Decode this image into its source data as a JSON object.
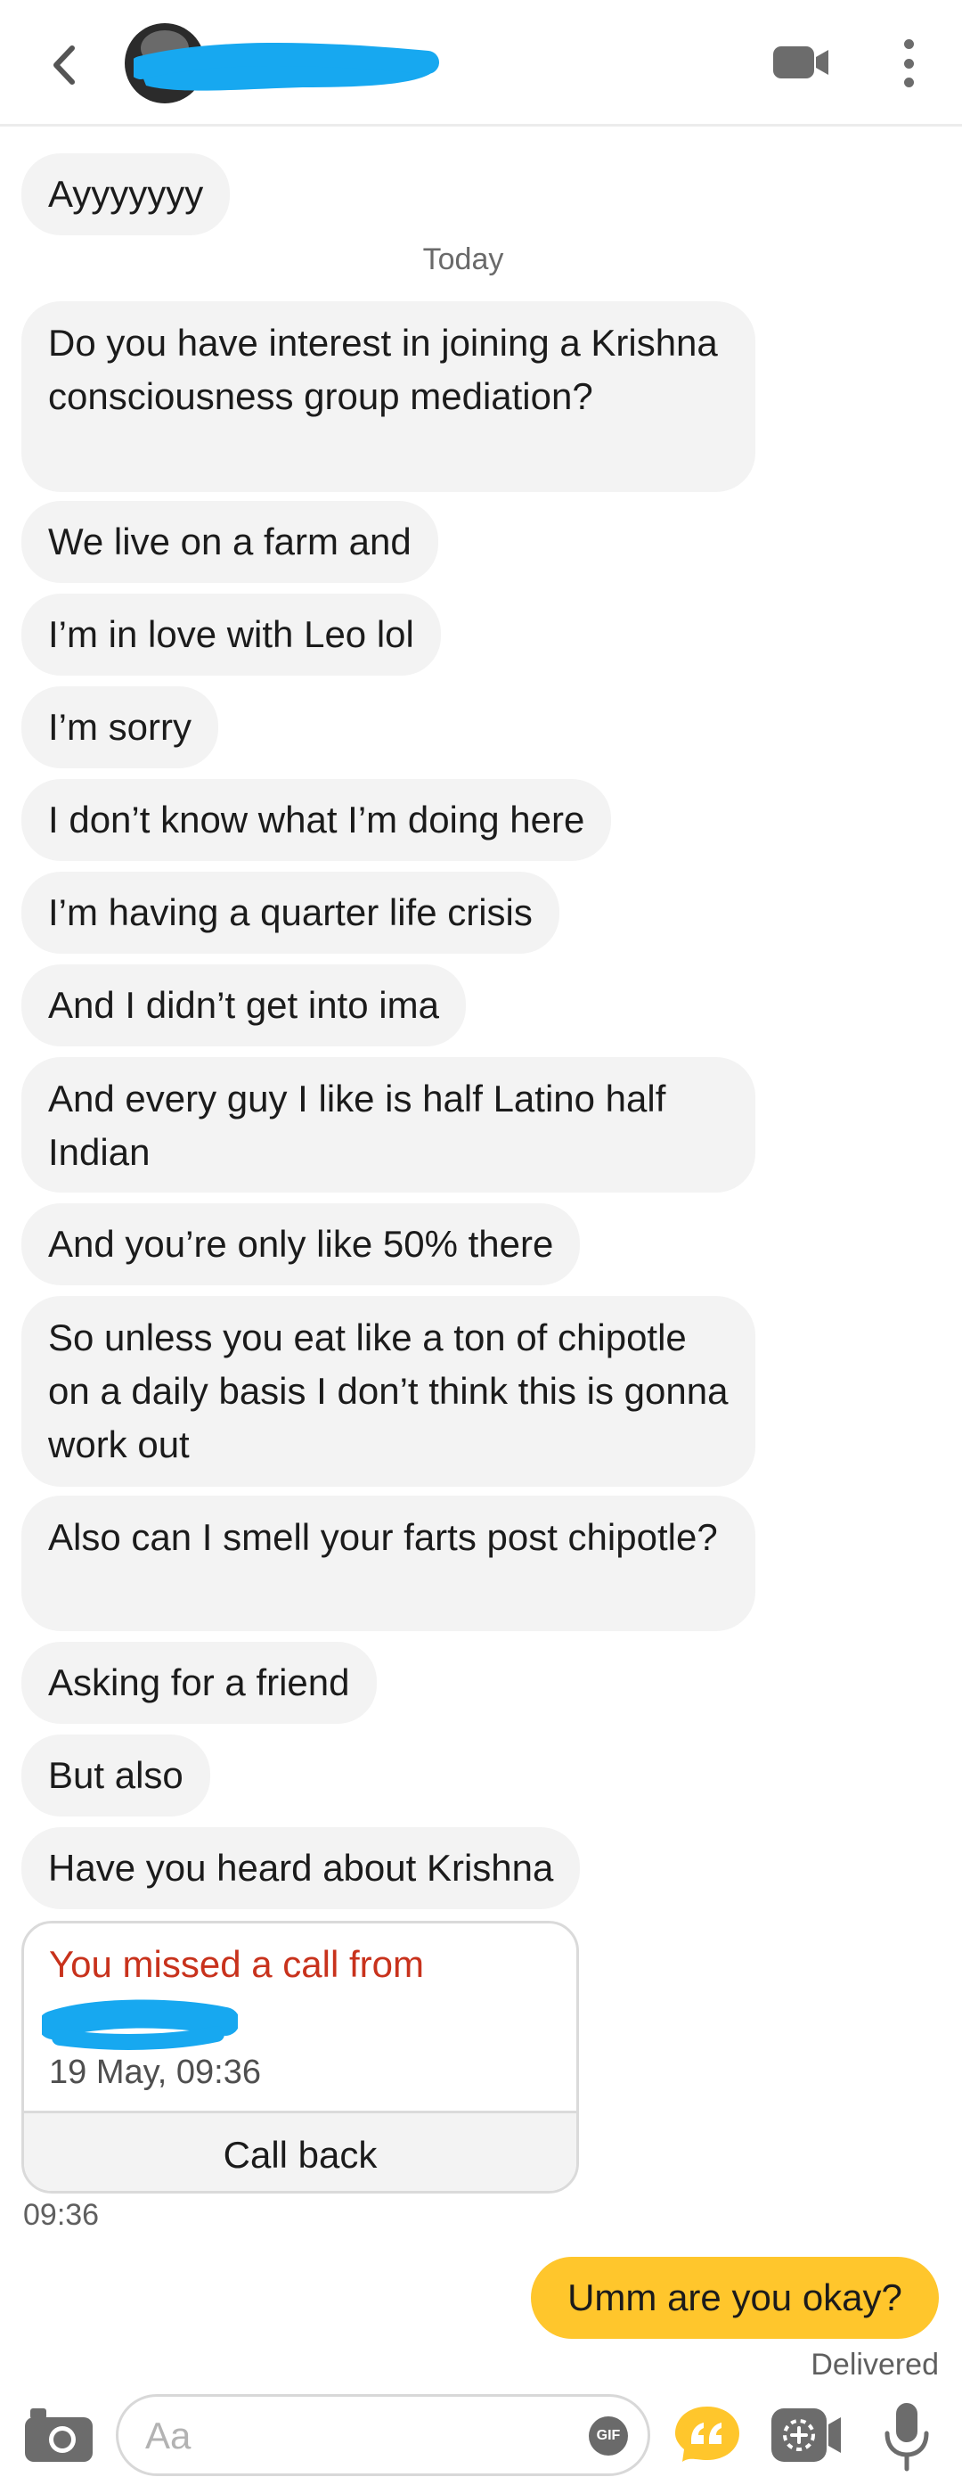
{
  "header": {
    "back_icon": "chevron-left-icon",
    "video_icon": "video-camera-icon",
    "more_icon": "more-vertical-icon"
  },
  "messages_before": [
    {
      "text": "Ayyyyyyy"
    }
  ],
  "day_separator": "Today",
  "incoming_messages": [
    {
      "text": "Do you have interest in joining a Krishna consciousness group mediation?"
    },
    {
      "text": "We live on a farm and"
    },
    {
      "text": "I’m in love with Leo lol"
    },
    {
      "text": "I’m sorry"
    },
    {
      "text": "I don’t know what I’m doing here"
    },
    {
      "text": "I’m having a quarter life crisis"
    },
    {
      "text": "And I didn’t get into ima"
    },
    {
      "text": "And every guy I like is half Latino half Indian"
    },
    {
      "text": "And you’re only like 50% there"
    },
    {
      "text": "So unless you eat like a ton of chipotle on a daily basis I don’t think this is gonna work out"
    },
    {
      "text": "Also can I smell your farts post chipotle?"
    },
    {
      "text": "Asking for a friend"
    },
    {
      "text": "But also"
    },
    {
      "text": "Have you heard about Krishna"
    }
  ],
  "missed_call": {
    "title": "You missed a call from",
    "datetime": "19 May, 09:36",
    "action": "Call back"
  },
  "call_timestamp": "09:36",
  "outgoing_message": {
    "text": "Umm are you okay?",
    "status": "Delivered"
  },
  "composer": {
    "placeholder": "Aa",
    "gif_label": "GIF",
    "camera_icon": "camera-icon",
    "quote_icon": "quote-icon",
    "sticker_icon": "sticker-icon",
    "mic_icon": "microphone-icon"
  },
  "colors": {
    "accent_yellow": "#ffc62c",
    "missed_red": "#c8321c",
    "redaction_blue": "#17a8f0",
    "bubble_gray": "#f3f3f3"
  }
}
